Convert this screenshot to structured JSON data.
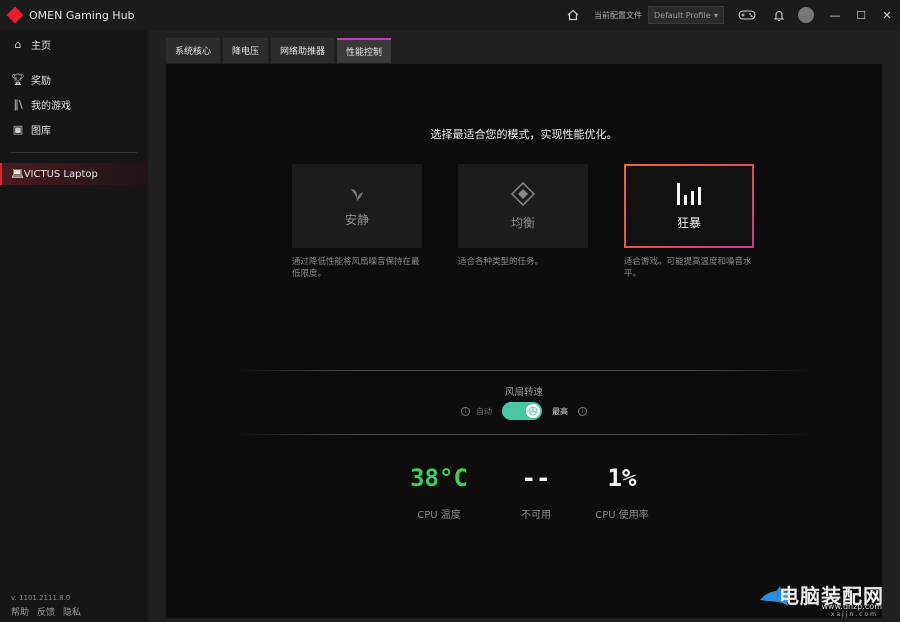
{
  "window": {
    "title": "OMEN Gaming Hub",
    "profile_label": "当前配置文件",
    "profile_value": "Default Profile",
    "icons": [
      "home-icon",
      "gamepad-icon",
      "bell-icon",
      "avatar"
    ]
  },
  "sidebar": {
    "items": [
      {
        "label": "主页",
        "icon": "home-icon"
      },
      {
        "label": "奖励",
        "icon": "trophy-icon"
      },
      {
        "label": "我的游戏",
        "icon": "library-icon"
      },
      {
        "label": "图库",
        "icon": "gallery-icon"
      }
    ],
    "device": "VICTUS Laptop",
    "version": "v. 1101.2111.8.0",
    "footer": [
      "帮助",
      "反馈",
      "隐私"
    ]
  },
  "tabs": [
    {
      "label": "系统核心",
      "active": false
    },
    {
      "label": "降电压",
      "active": false
    },
    {
      "label": "网络助推器",
      "active": false
    },
    {
      "label": "性能控制",
      "active": true
    }
  ],
  "performance": {
    "heading": "选择最适合您的模式，实现性能优化。",
    "modes": [
      {
        "name": "安静",
        "icon": "leaf-icon",
        "desc": "通过降低性能将风扇噪音保持在最低限度。",
        "selected": false
      },
      {
        "name": "均衡",
        "icon": "diamond-icon",
        "desc": "适合各种类型的任务。",
        "selected": false
      },
      {
        "name": "狂暴",
        "icon": "bars-icon",
        "desc": "适合游戏。可能提高温度和噪音水平。",
        "selected": true
      }
    ]
  },
  "fan": {
    "title": "风扇转速",
    "auto_label": "自动",
    "max_label": "最高",
    "toggle_on": true
  },
  "stats": [
    {
      "value": "38°C",
      "label": "CPU 温度",
      "accent": "#3ccf5a"
    },
    {
      "value": "--",
      "label": "不可用"
    },
    {
      "value": "1%",
      "label": "CPU 使用率"
    }
  ],
  "watermark": {
    "big": "电脑装配网",
    "url": "www.dnzp.com",
    "sub": "xajjn.com"
  }
}
